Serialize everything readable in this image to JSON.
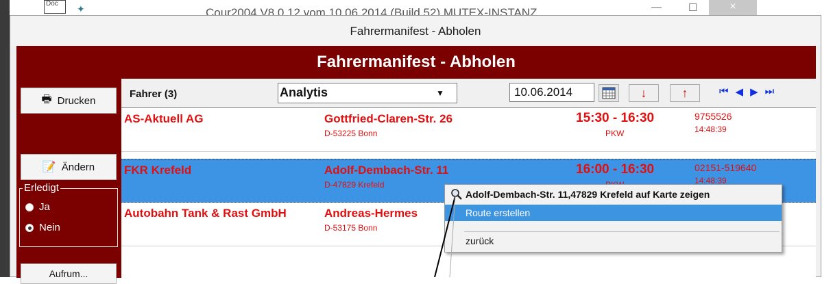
{
  "background_window": {
    "doc_label": "Doc",
    "title": "Cour2004 V8.0.12 vom 10.06.2014 (Build 52) MUTEX-INSTANZ",
    "min_glyph": "—",
    "max_glyph": "☐",
    "close_glyph": "×"
  },
  "window": {
    "title": "Fahrermanifest - Abholen",
    "banner": "Fahrermanifest - Abholen"
  },
  "sidebar": {
    "print_label": "Drucken",
    "edit_label": "Ändern",
    "erledigt_label": "Erledigt",
    "radio_yes": "Ja",
    "radio_no": "Nein",
    "radio_selected": "Nein",
    "next_button_partial": "Aufrum..."
  },
  "toolbar": {
    "driver_label": "Fahrer (3)",
    "driver_value": "Analytis",
    "date_value": "10.06.2014"
  },
  "rows": [
    {
      "name": "AS-Aktuell AG",
      "street": "Gottfried-Claren-Str. 26",
      "city": "D-53225 Bonn",
      "time": "15:30 - 16:30",
      "vehicle": "PKW",
      "phone": "9755526",
      "clock": "14:48:39",
      "selected": false
    },
    {
      "name": "FKR  Krefeld",
      "street": "Adolf-Dembach-Str. 11",
      "city": "D-47829 Krefeld",
      "time": "16:00 - 16:30",
      "vehicle": "PKW",
      "phone": "02151-519640",
      "clock": "14:48:39",
      "selected": true
    },
    {
      "name": "Autobahn Tank & Rast GmbH",
      "street": "Andreas-Hermes",
      "city": "D-53175 Bonn",
      "time": "",
      "vehicle": "",
      "phone": "",
      "clock": "",
      "selected": false
    }
  ],
  "context_menu": {
    "items": [
      {
        "label": "Adolf-Dembach-Str. 11,47829 Krefeld auf Karte zeigen",
        "bold": true,
        "icon": "magnifier-icon"
      },
      {
        "label": "Route erstellen",
        "highlighted": true
      },
      {
        "label": "zurück"
      }
    ]
  },
  "colors": {
    "banner": "#7b0000",
    "row_text": "#e01010",
    "selection": "#3e94e4",
    "menu_highlight": "#3d95e2",
    "nav_blue": "#1030e0"
  }
}
